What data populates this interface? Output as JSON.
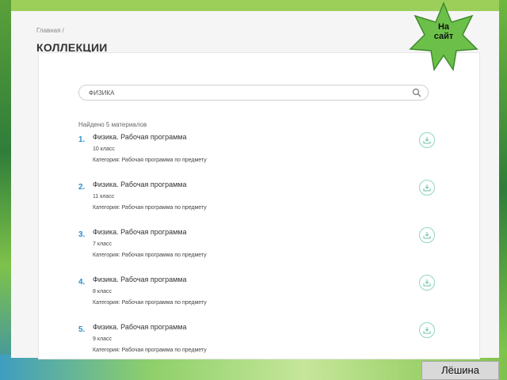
{
  "breadcrumb": "Главная  /",
  "page_title": "КОЛЛЕКЦИИ",
  "search": {
    "value": "ФИЗИКА"
  },
  "found_text": "Найдено 5 материалов",
  "results": [
    {
      "num": "1.",
      "title": "Физика. Рабочая программа",
      "grade": "10 класс",
      "category": "Категория: Рабочая программа по предмету"
    },
    {
      "num": "2.",
      "title": "Физика. Рабочая программа",
      "grade": "11 класс",
      "category": "Категория: Рабочая программа по предмету"
    },
    {
      "num": "3.",
      "title": "Физика. Рабочая программа",
      "grade": "7 класс",
      "category": "Категория: Рабочая программа по предмету"
    },
    {
      "num": "4.",
      "title": "Физика. Рабочая программа",
      "grade": "8 класс",
      "category": "Категория: Рабочая программа по предмету"
    },
    {
      "num": "5.",
      "title": "Физика. Рабочая программа",
      "grade": "9 класс",
      "category": "Категория: Рабочая программа по предмету"
    }
  ],
  "badge": {
    "line1": "На",
    "line2": "сайт"
  },
  "author": "Лёшина",
  "colors": {
    "accent": "#2a8fd0",
    "download_ring": "#8fd6bf",
    "star": "#6cc04a"
  }
}
